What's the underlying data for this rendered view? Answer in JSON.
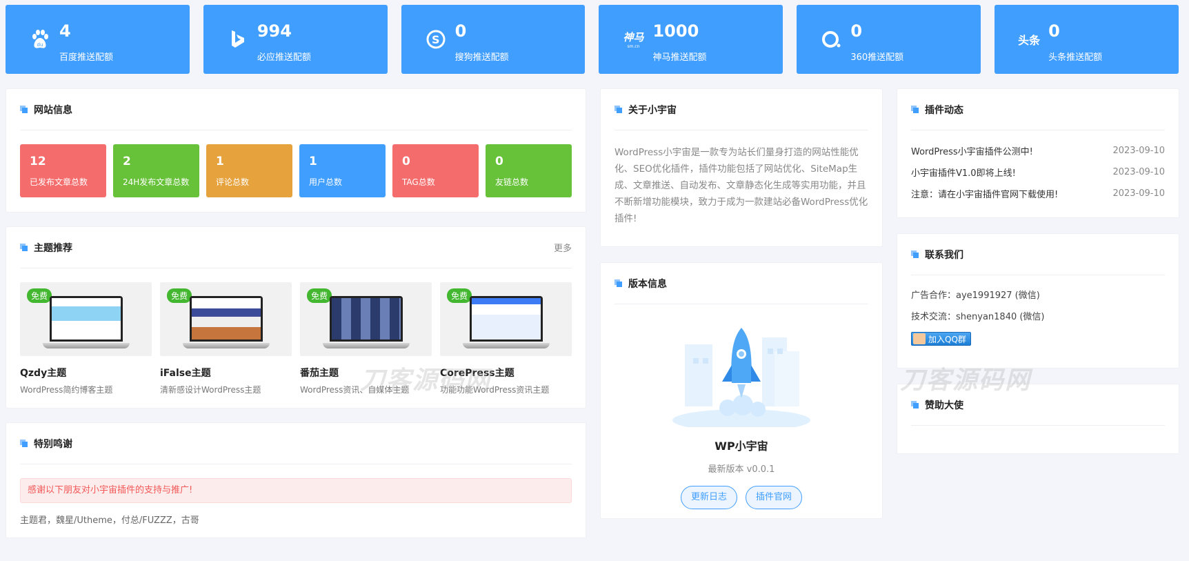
{
  "stats": [
    {
      "icon": "baidu-icon",
      "value": "4",
      "label": "百度推送配额"
    },
    {
      "icon": "bing-icon",
      "value": "994",
      "label": "必应推送配额"
    },
    {
      "icon": "sogou-icon",
      "value": "0",
      "label": "搜狗推送配额"
    },
    {
      "icon": "shenma-icon",
      "value": "1000",
      "label": "神马推送配额",
      "icon_text": "神马",
      "icon_sub": "sm.cn"
    },
    {
      "icon": "360-icon",
      "value": "0",
      "label": "360推送配额"
    },
    {
      "icon": "toutiao-icon",
      "value": "0",
      "label": "头条推送配额",
      "icon_text": "头条"
    }
  ],
  "site_info": {
    "title": "网站信息",
    "items": [
      {
        "value": "12",
        "label": "已发布文章总数",
        "color": "#f56c6c"
      },
      {
        "value": "2",
        "label": "24H发布文章总数",
        "color": "#67c23a"
      },
      {
        "value": "1",
        "label": "评论总数",
        "color": "#e6a23c"
      },
      {
        "value": "1",
        "label": "用户总数",
        "color": "#409eff"
      },
      {
        "value": "0",
        "label": "TAG总数",
        "color": "#f56c6c"
      },
      {
        "value": "0",
        "label": "友链总数",
        "color": "#67c23a"
      }
    ]
  },
  "themes": {
    "title": "主题推荐",
    "more": "更多",
    "items": [
      {
        "badge": "免费",
        "name": "Qzdy主题",
        "desc": "WordPress简约博客主题"
      },
      {
        "badge": "免费",
        "name": "iFalse主题",
        "desc": "清新感设计WordPress主题"
      },
      {
        "badge": "免费",
        "name": "番茄主题",
        "desc": "WordPress资讯、自媒体主题"
      },
      {
        "badge": "免费",
        "name": "CorePress主题",
        "desc": "功能功能WordPress资讯主题"
      }
    ]
  },
  "thanks": {
    "title": "特别鸣谢",
    "notice": "感谢以下朋友对小宇宙插件的支持与推广!",
    "names": "主题君，魏星/Utheme，付总/FUZZZ，古哥"
  },
  "about": {
    "title": "关于小宇宙",
    "text": "WordPress小宇宙是一款专为站长们量身打造的网站性能优化、SEO优化插件，插件功能包括了网站优化、SiteMap生成、文章推送、自动发布、文章静态化生成等实用功能，并且不断新增功能模块，致力于成为一款建站必备WordPress优化插件!"
  },
  "version": {
    "title": "版本信息",
    "name": "WP小宇宙",
    "latest": "最新版本 v0.0.1",
    "btn_changelog": "更新日志",
    "btn_site": "插件官网"
  },
  "news": {
    "title": "插件动态",
    "items": [
      {
        "text": "WordPress小宇宙插件公测中!",
        "date": "2023-09-10"
      },
      {
        "text": "小宇宙插件V1.0即将上线!",
        "date": "2023-09-10"
      },
      {
        "text": "注意：请在小宇宙插件官网下载使用!",
        "date": "2023-09-10"
      }
    ]
  },
  "contact": {
    "title": "联系我们",
    "ad": "广告合作：aye1991927 (微信)",
    "tech": "技术交流：shenyan1840 (微信)",
    "qq_btn": "加入QQ群"
  },
  "sponsor": {
    "title": "赞助大使"
  },
  "watermark": "刀客源码网"
}
